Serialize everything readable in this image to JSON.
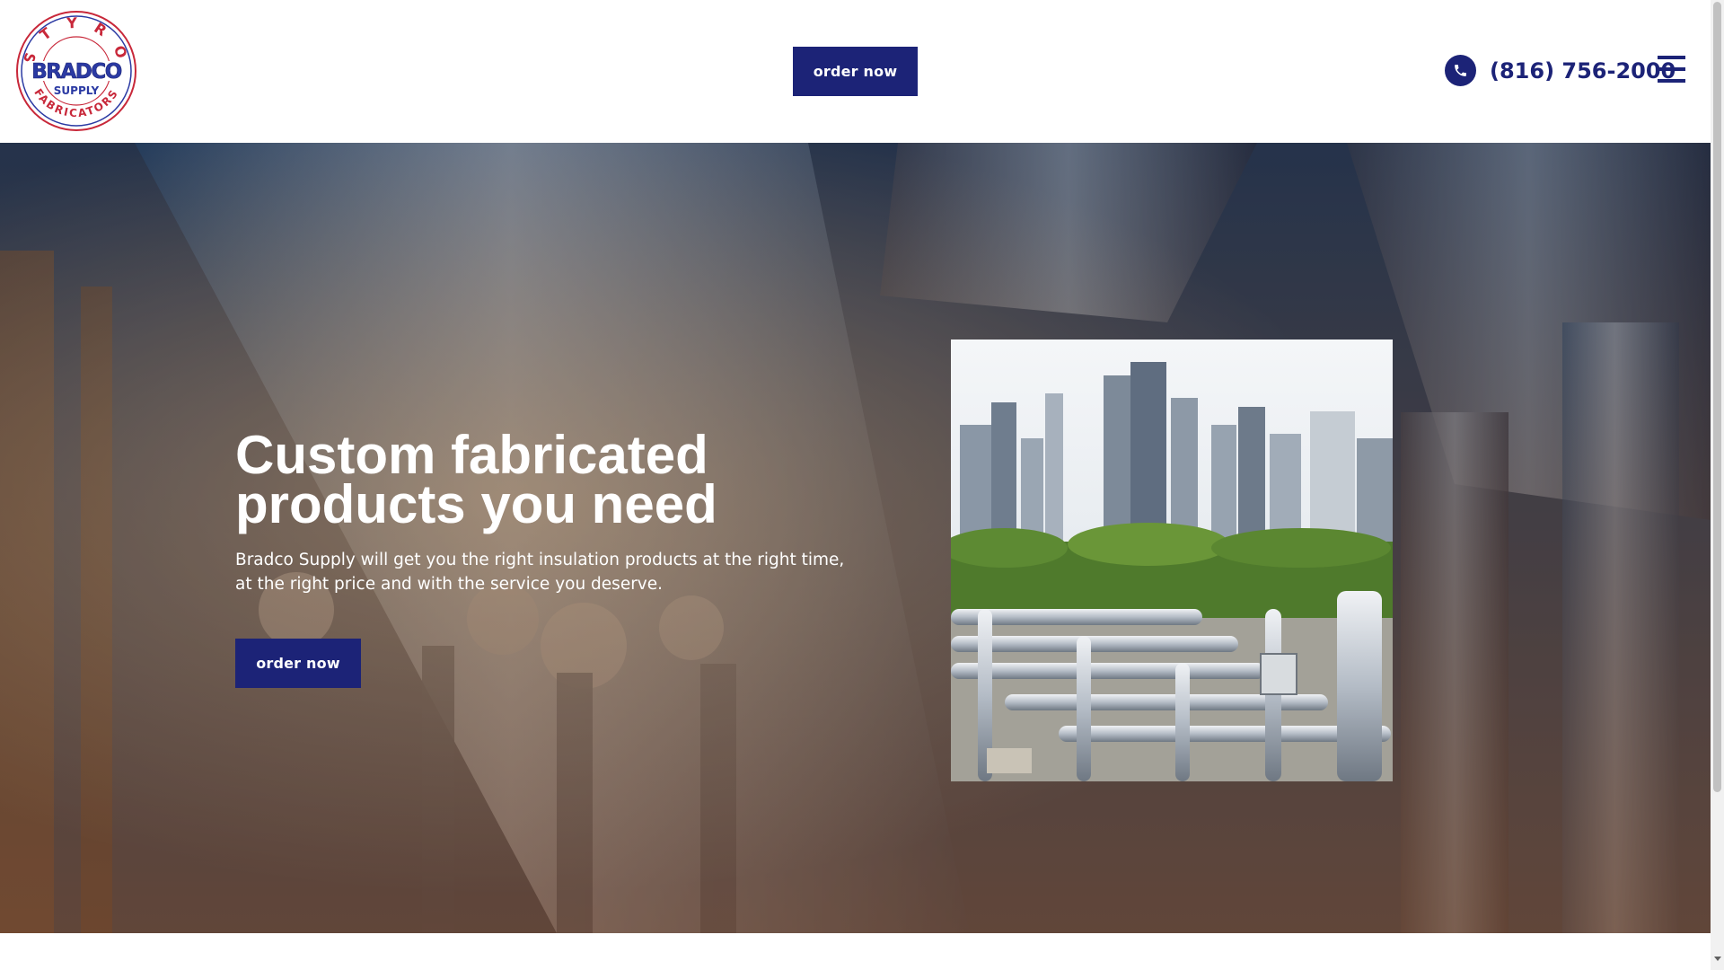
{
  "header": {
    "logo": {
      "ring_top_text": "S T Y R O",
      "ring_bottom_text": "FABRICATORS",
      "brand_text": "BRADCO",
      "sub_text": "SUPPLY"
    },
    "order_button_label": "order now",
    "phone_number": "(816) 756-2000",
    "phone_icon": "phone-icon",
    "menu_icon": "hamburger-menu-icon"
  },
  "hero": {
    "title": "Custom fabricated products you need",
    "subtitle": "Bradco Supply will get you the right insulation products at the right time, at the right price and with the service you deserve.",
    "order_button_label": "order now",
    "background_image": "industrial-pipes-photo",
    "feature_image": "city-skyline-pipe-rack-photo"
  },
  "colors": {
    "brand_navy": "#1c2377",
    "logo_red": "#c8283a",
    "logo_blue": "#2b3aa3",
    "white": "#ffffff"
  }
}
